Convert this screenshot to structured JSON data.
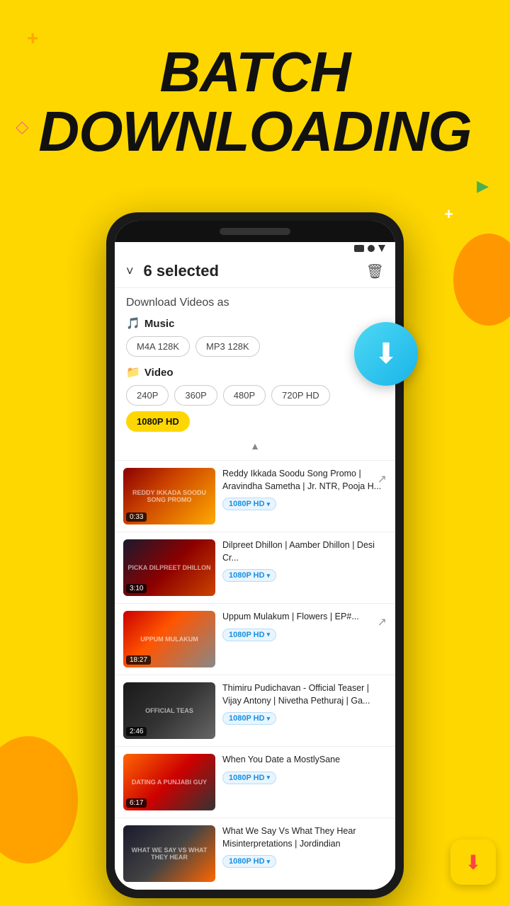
{
  "background": {
    "color": "#FFD700"
  },
  "hero": {
    "title_line1": "BATCH",
    "title_line2": "DOWNLOADING",
    "bg_text": "BATCH"
  },
  "header": {
    "chevron": "˅",
    "selected_text": "6 selected",
    "trash_icon": "🗑"
  },
  "download_panel": {
    "title": "Download Videos as",
    "music_label": "Music",
    "music_icon": "🎵",
    "music_options": [
      "M4A 128K",
      "MP3 128K"
    ],
    "video_label": "Video",
    "video_icon": "📁",
    "video_options": [
      "240P",
      "360P",
      "480P",
      "720P HD",
      "1080P HD"
    ],
    "active_option": "1080P HD"
  },
  "videos": [
    {
      "title": "Reddy Ikkada Soodu Song Promo | Aravindha Sametha | Jr. NTR, Pooja H...",
      "duration": "0:33",
      "quality": "1080P HD",
      "thumb_class": "thumb-v1",
      "thumb_label": "REDDY IKKADA SOODU SONG PROMO"
    },
    {
      "title": "Dilpreet Dhillon | Aamber Dhillon | Desi Cr...",
      "duration": "3:10",
      "quality": "1080P HD",
      "thumb_class": "thumb-v2",
      "thumb_label": "PICKA DILPREET DHILLON"
    },
    {
      "title": "Uppum Mulakum | Flowers | EP#...",
      "duration": "18:27",
      "quality": "1080P HD",
      "thumb_class": "thumb-v3",
      "thumb_label": "UPPUM MULAKUM"
    },
    {
      "title": "Thimiru Pudichavan - Official Teaser | Vijay Antony | Nivetha Pethuraj | Ga...",
      "duration": "2:46",
      "quality": "1080P HD",
      "thumb_class": "thumb-v4",
      "thumb_label": "OFFICIAL TEAS"
    },
    {
      "title": "When You Date a MostlySane",
      "duration": "6:17",
      "quality": "1080P HD",
      "thumb_class": "thumb-v5",
      "thumb_label": "DATING A PUNJABI GUY"
    },
    {
      "title": "What We Say Vs What They Hear Misinterpretations | Jordindian",
      "duration": "",
      "quality": "1080P HD",
      "thumb_class": "thumb-v6",
      "thumb_label": "WHAT WE SAY VS WHAT THEY HEAR"
    }
  ],
  "app_icon": {
    "arrow": "⬇"
  }
}
